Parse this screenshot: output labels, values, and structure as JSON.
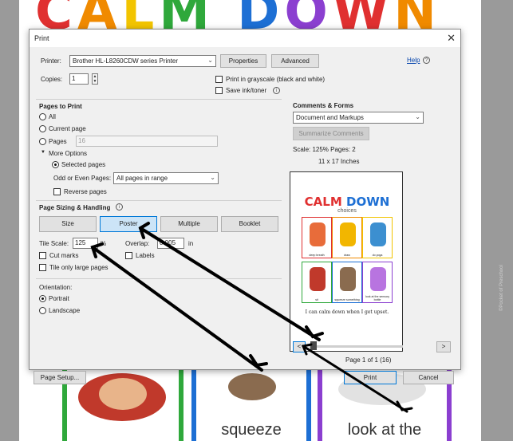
{
  "background": {
    "banner_letters": [
      "C",
      "A",
      "L",
      "M",
      "D",
      "O",
      "W",
      "N"
    ],
    "card_words": [
      "",
      "squeeze",
      "look at the"
    ],
    "side_text": "©Pocket of Preschool"
  },
  "dialog": {
    "title": "Print",
    "printer_label": "Printer:",
    "printer_value": "Brother HL-L8260CDW series Printer",
    "properties_button": "Properties",
    "advanced_button": "Advanced",
    "help_link": "Help",
    "copies_label": "Copies:",
    "copies_value": "1",
    "grayscale_label": "Print in grayscale (black and white)",
    "save_ink_label": "Save ink/toner",
    "pages_to_print": {
      "heading": "Pages to Print",
      "all": "All",
      "current_page": "Current page",
      "pages": "Pages",
      "pages_value": "16",
      "more_options": "More Options",
      "selected_pages": "Selected pages",
      "odd_even_label": "Odd or Even Pages:",
      "odd_even_value": "All pages in range",
      "reverse_pages": "Reverse pages"
    },
    "sizing": {
      "heading": "Page Sizing & Handling",
      "tabs": [
        "Size",
        "Poster",
        "Multiple",
        "Booklet"
      ],
      "tile_scale_label": "Tile Scale:",
      "tile_scale_value": "125",
      "percent": "%",
      "overlap_label": "Overlap:",
      "overlap_value": "0.005",
      "overlap_unit": "in",
      "cut_marks": "Cut marks",
      "labels": "Labels",
      "tile_only_large": "Tile only large pages"
    },
    "orientation": {
      "heading": "Orientation:",
      "portrait": "Portrait",
      "landscape": "Landscape"
    },
    "comments": {
      "heading": "Comments & Forms",
      "value": "Document and Markups",
      "summarize_button": "Summarize Comments"
    },
    "preview": {
      "scale_text": "Scale: 125% Pages: 2",
      "size_text": "11 x 17 Inches",
      "title_letters": [
        "CALM",
        "DOWN"
      ],
      "subtitle": "choices",
      "cells": [
        "deep breath",
        "draw",
        "do yoga",
        "sit",
        "squeeze something",
        "look at the sensory bottle"
      ],
      "footer": "I can calm down when I get upset.",
      "page_indicator": "Page 1 of 1 (16)",
      "prev_button": "<",
      "next_button": ">"
    },
    "page_setup_button": "Page Setup...",
    "print_button": "Print",
    "cancel_button": "Cancel"
  },
  "colors": {
    "accent": "#0078d7",
    "arrow": "#000000",
    "link": "#0645ad"
  }
}
